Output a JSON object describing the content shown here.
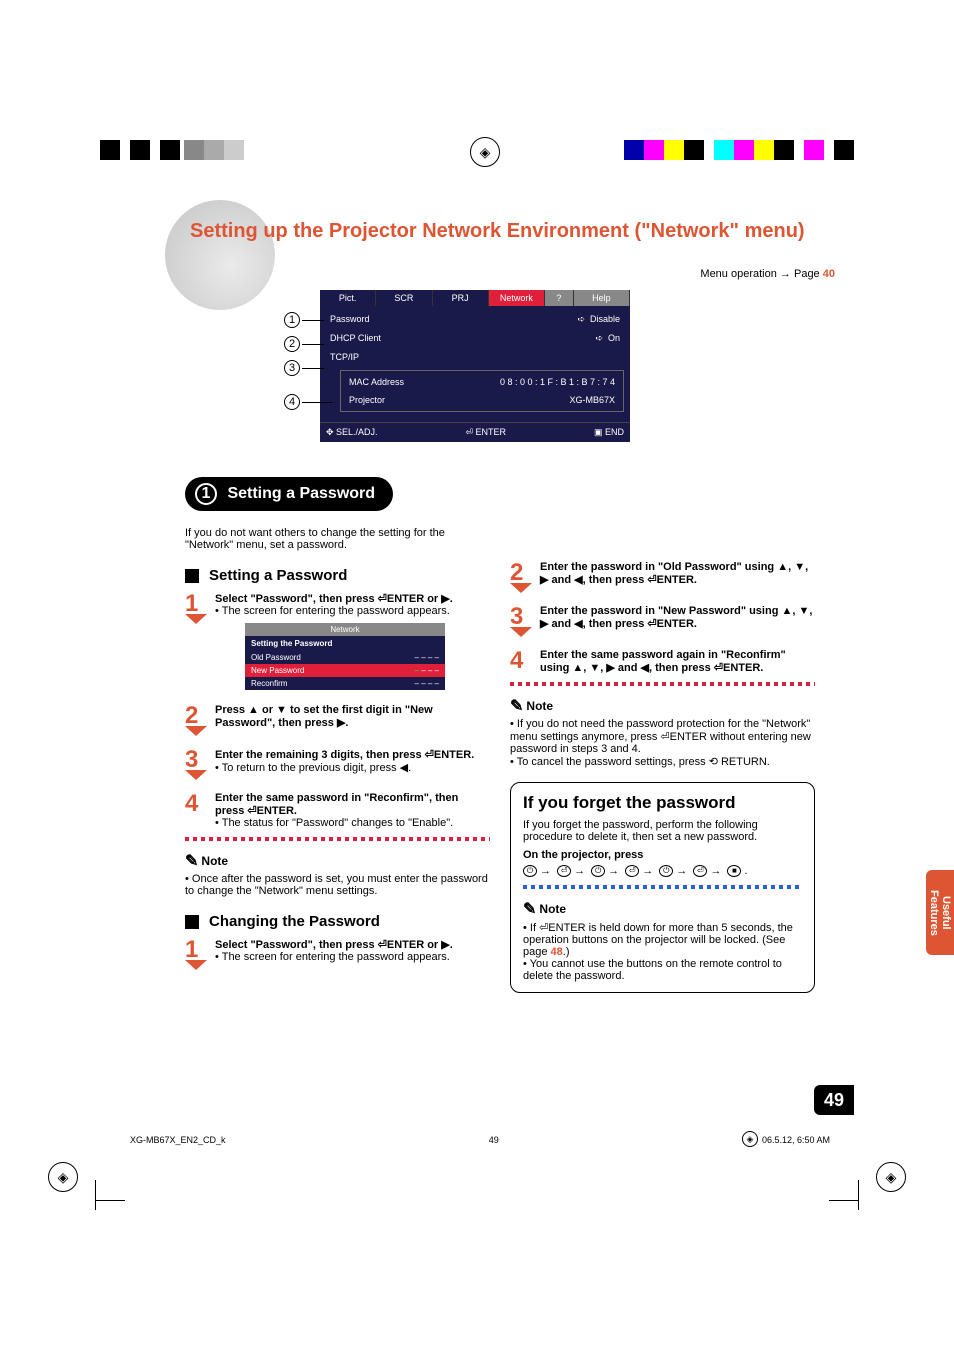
{
  "registration": {
    "colors_left": [
      "#000",
      "#000",
      "#000",
      "#888",
      "#aaa",
      "#ccc"
    ],
    "colors_right": [
      "#00a",
      "#f0f",
      "#ff0",
      "#000",
      "#0ff",
      "#f0f",
      "#ff0",
      "#000",
      "#f0f",
      "#000"
    ]
  },
  "title": "Setting up the Projector Network Environment (\"Network\" menu)",
  "menu_operation": {
    "label": "Menu operation",
    "arrow": "→",
    "page_word": "Page",
    "page": "40"
  },
  "osd": {
    "tabs": [
      "Pict.",
      "SCR",
      "PRJ",
      "Network",
      "?",
      "Help"
    ],
    "rows": [
      {
        "num": "1",
        "label": "Password",
        "value": "Disable",
        "arrow": true
      },
      {
        "num": "2",
        "label": "DHCP Client",
        "value": "On",
        "arrow": true
      },
      {
        "num": "3",
        "label": "TCP/IP",
        "value": "",
        "arrow": false
      }
    ],
    "sub_num": "4",
    "sub_rows": [
      {
        "label": "MAC Address",
        "value": "0 8 : 0 0 : 1 F : B 1 : B 7 : 7 4"
      },
      {
        "label": "Projector",
        "value": "XG-MB67X"
      }
    ],
    "footer": {
      "sel": "SEL./ADJ.",
      "enter": "ENTER",
      "end": "END"
    }
  },
  "section1": {
    "num": "1",
    "title": "Setting a Password"
  },
  "intro": "If you do not want others to change the setting for the \"Network\" menu, set a password.",
  "left": {
    "setting_heading": "Setting a Password",
    "steps": [
      {
        "n": "1",
        "bold": "Select \"Password\", then press ⏎ENTER or ▶.",
        "note": "The screen for entering the password appears."
      },
      {
        "n": "2",
        "bold": "Press ▲ or ▼ to set the first digit in \"New Password\", then press ▶."
      },
      {
        "n": "3",
        "bold": "Enter the remaining 3 digits, then press ⏎ENTER.",
        "note": "To return to the previous digit, press ◀."
      },
      {
        "n": "4",
        "bold": "Enter the same password in \"Reconfirm\", then press ⏎ENTER.",
        "note": "The status for \"Password\" changes to \"Enable\"."
      }
    ],
    "mini_osd": {
      "tab": "Network",
      "heading": "Setting the Password",
      "rows": [
        {
          "label": "Old Password",
          "value": "– – – –"
        },
        {
          "label": "New Password",
          "value": "– – – –",
          "sel": true
        },
        {
          "label": "Reconfirm",
          "value": "– – – –"
        }
      ]
    },
    "note_label": "Note",
    "note_text": "Once after the password is set, you must enter the password to change the \"Network\" menu settings.",
    "changing_heading": "Changing the Password",
    "change_step": {
      "n": "1",
      "bold": "Select \"Password\", then press ⏎ENTER or ▶.",
      "note": "The screen for entering the password appears."
    }
  },
  "right": {
    "steps": [
      {
        "n": "2",
        "bold": "Enter the password in \"Old Password\" using ▲, ▼, ▶ and ◀, then press ⏎ENTER."
      },
      {
        "n": "3",
        "bold": "Enter the password in \"New Password\" using ▲, ▼, ▶ and ◀, then press ⏎ENTER."
      },
      {
        "n": "4",
        "bold": "Enter the same password again in \"Reconfirm\" using ▲, ▼, ▶ and ◀, then press ⏎ENTER."
      }
    ],
    "note_label": "Note",
    "note_bullets": [
      "If you do not need the password protection for the \"Network\" menu settings anymore, press ⏎ENTER without entering new password in steps 3 and 4.",
      "To cancel the password settings, press ⟲ RETURN."
    ],
    "forget": {
      "title": "If you forget the password",
      "text": "If you forget the password, perform the following procedure to delete it, then set a new password.",
      "press_label": "On the projector, press",
      "sequence": [
        "◦",
        "⏎",
        "◦",
        "⏎",
        "◦",
        "⏎",
        "■"
      ],
      "note_label": "Note",
      "note_bullets": [
        {
          "pre": "If ⏎ENTER is held down for more than 5 seconds, the operation buttons on the projector will be locked. (See page ",
          "link": "48",
          "post": ".)"
        },
        {
          "pre": "You cannot use the buttons on the remote control to delete the password.",
          "link": "",
          "post": ""
        }
      ]
    }
  },
  "side_tab": "Useful Features",
  "page_number": "49",
  "footer": {
    "file": "XG-MB67X_EN2_CD_k",
    "page": "49",
    "ts": "06.5.12, 6:50 AM"
  }
}
